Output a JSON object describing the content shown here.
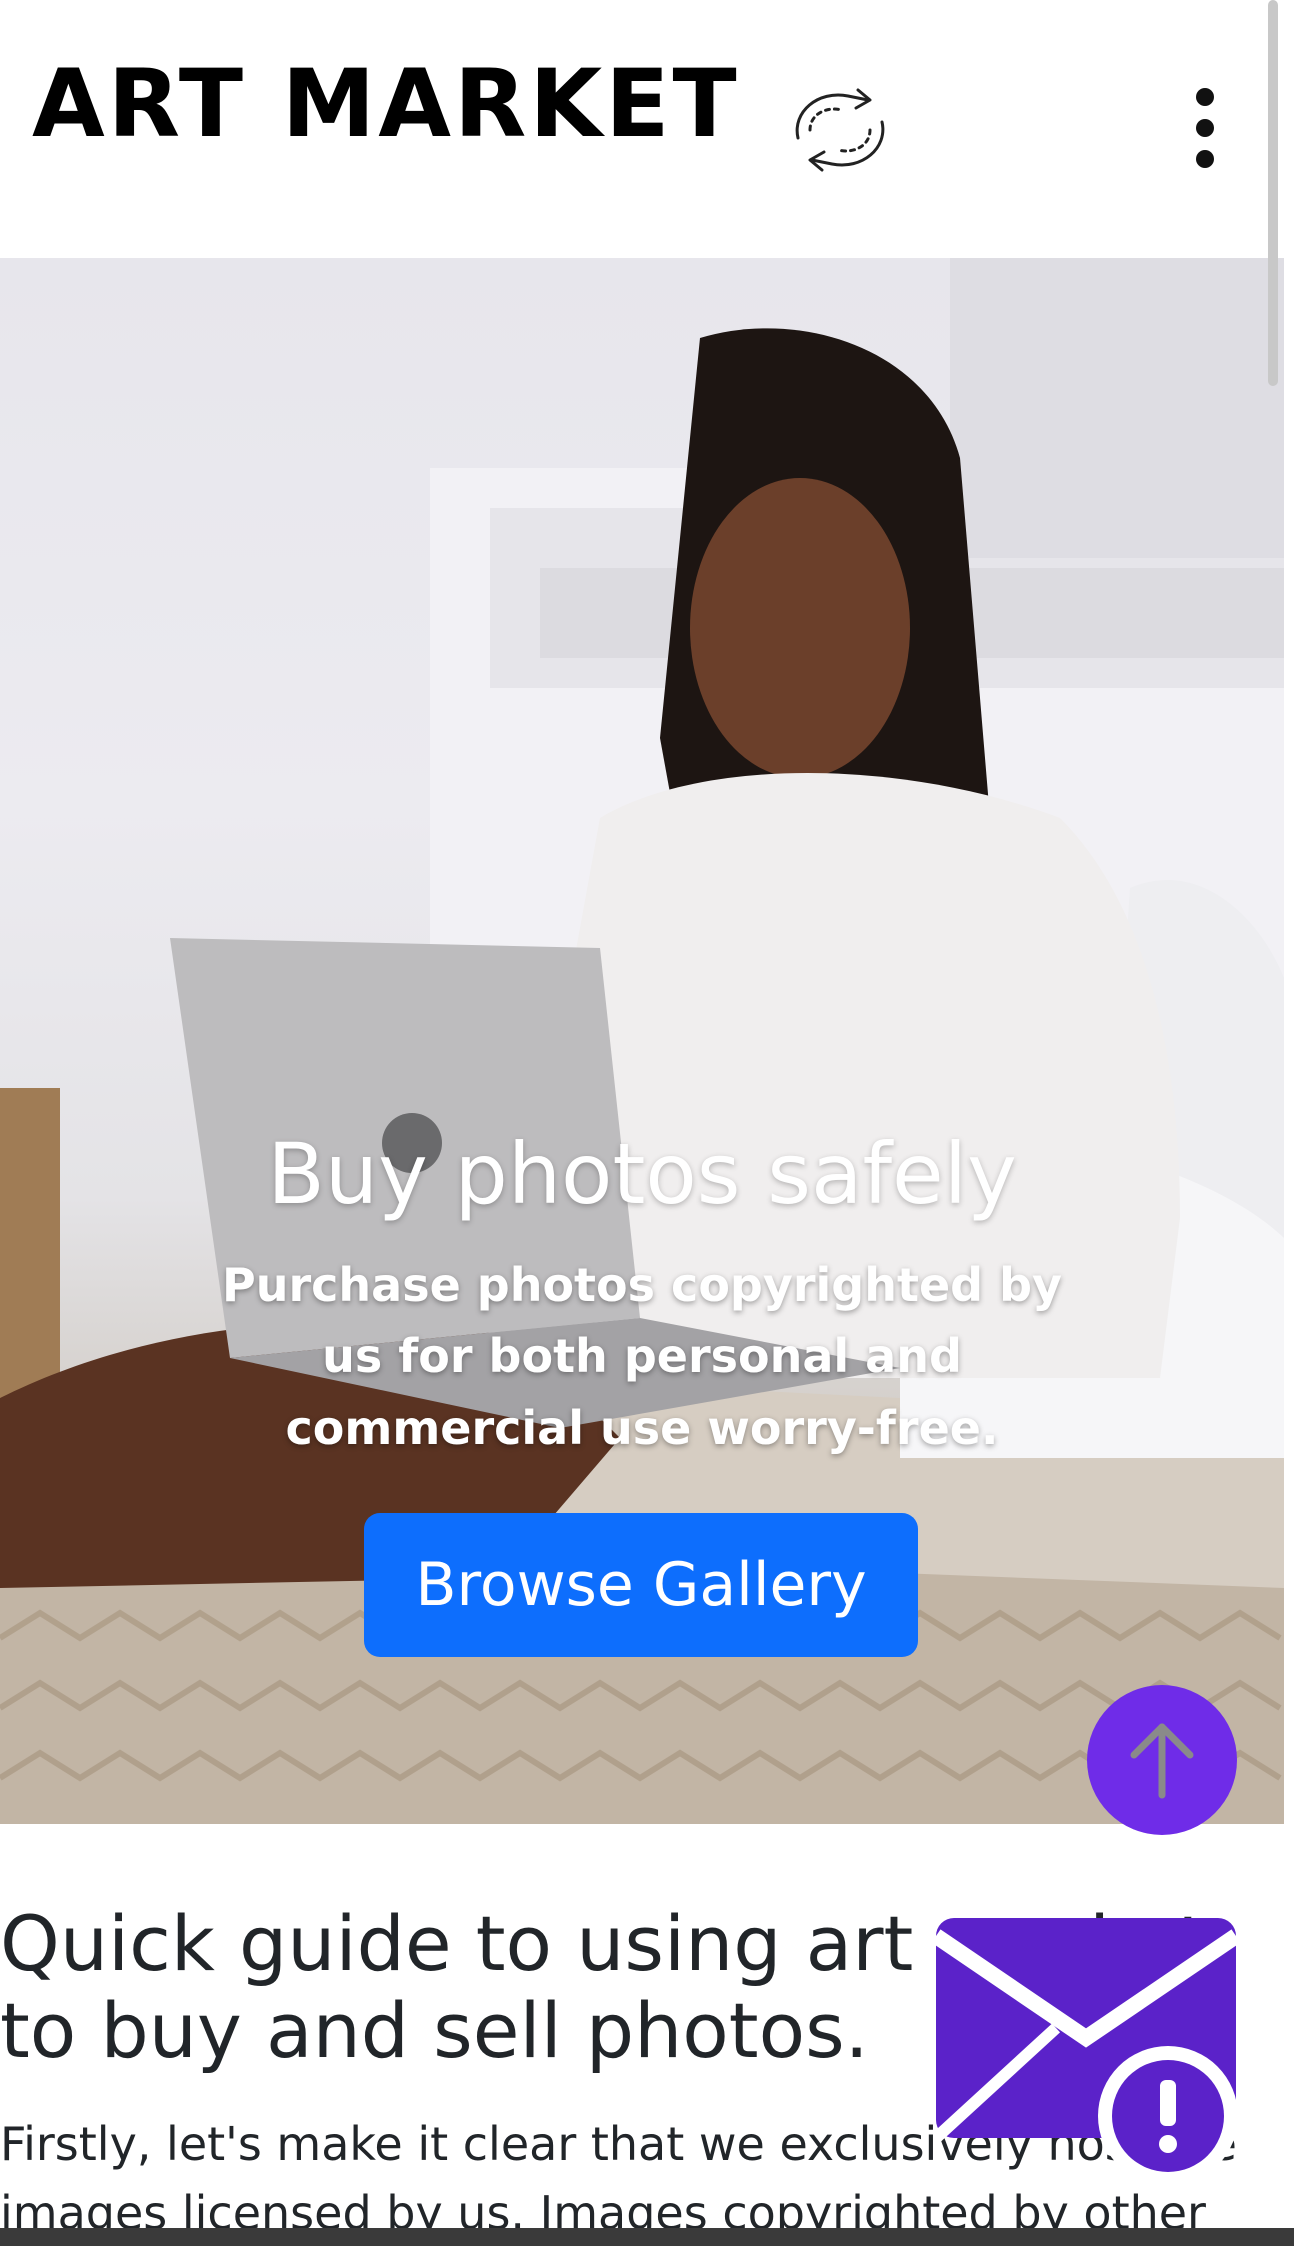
{
  "header": {
    "brand": "ART MARKET",
    "sync_icon": "sync-arrows-icon",
    "menu_icon": "kebab-menu-icon"
  },
  "hero": {
    "title": "Buy photos safely",
    "subtitle": "Purchase photos copyrighted by us for both personal and commercial use worry-free.",
    "button_label": "Browse Gallery"
  },
  "guide": {
    "title": "Quick guide to using art market to buy and sell photos.",
    "text": "Firstly, let's make it clear that we exclusively host the images licensed by us. Images copyrighted by other"
  },
  "floating": {
    "scroll_top_icon": "arrow-up-icon",
    "mail_alert_icon": "mail-alert-icon"
  },
  "colors": {
    "primary": "#0d6efd",
    "accent_purple": "#6f2ce8",
    "mail_purple": "#5b22c9"
  }
}
